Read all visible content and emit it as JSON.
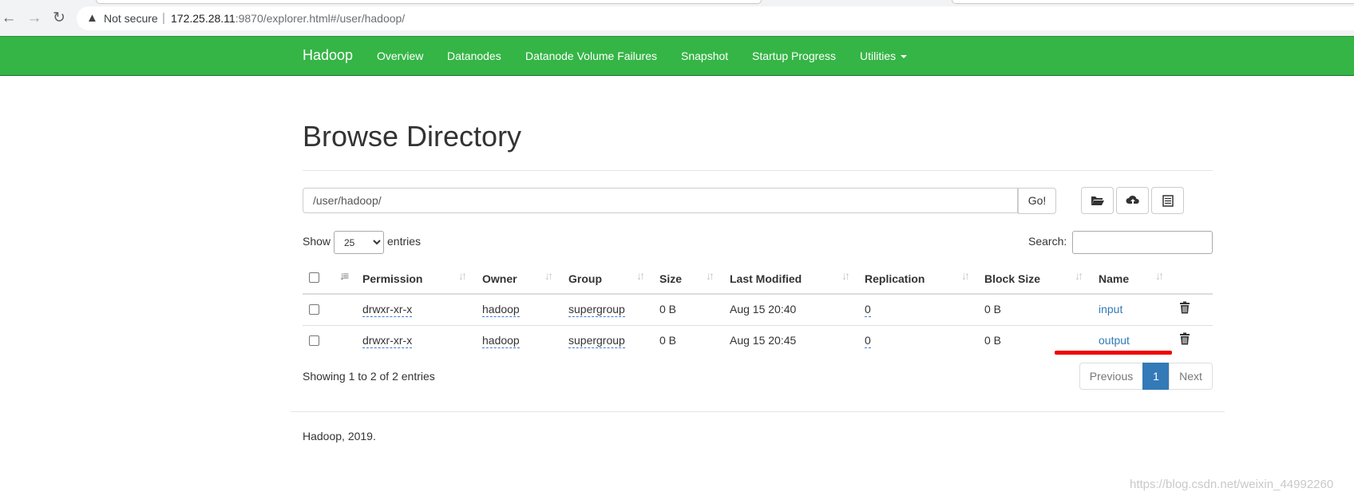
{
  "browser": {
    "security_label": "Not secure",
    "url_host": "172.25.28.11",
    "url_rest": ":9870/explorer.html#/user/hadoop/"
  },
  "navbar": {
    "brand": "Hadoop",
    "items": [
      "Overview",
      "Datanodes",
      "Datanode Volume Failures",
      "Snapshot",
      "Startup Progress",
      "Utilities"
    ]
  },
  "main": {
    "title": "Browse Directory",
    "path_value": "/user/hadoop/",
    "go_label": "Go!",
    "show_label": "Show",
    "page_length": "25",
    "entries_label": "entries",
    "search_label": "Search:"
  },
  "table": {
    "columns": [
      "Permission",
      "Owner",
      "Group",
      "Size",
      "Last Modified",
      "Replication",
      "Block Size",
      "Name"
    ],
    "rows": [
      {
        "permission": "drwxr-xr-x",
        "owner": "hadoop",
        "group": "supergroup",
        "size": "0 B",
        "modified": "Aug 15 20:40",
        "replication": "0",
        "block_size": "0 B",
        "name": "input"
      },
      {
        "permission": "drwxr-xr-x",
        "owner": "hadoop",
        "group": "supergroup",
        "size": "0 B",
        "modified": "Aug 15 20:45",
        "replication": "0",
        "block_size": "0 B",
        "name": "output"
      }
    ]
  },
  "pagination": {
    "info": "Showing 1 to 2 of 2 entries",
    "previous": "Previous",
    "current": "1",
    "next": "Next"
  },
  "footer": "Hadoop, 2019.",
  "watermark": "https://blog.csdn.net/weixin_44992260",
  "colors": {
    "navbar": "#35b546",
    "link": "#337ab7",
    "highlight": "#ef0000"
  }
}
